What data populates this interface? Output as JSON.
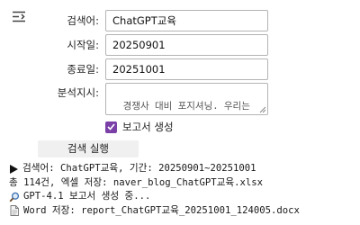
{
  "form": {
    "search_label": "검색어:",
    "search_value": "ChatGPT교육",
    "start_label": "시작일:",
    "start_value": "20250901",
    "end_label": "종료일:",
    "end_value": "20251001",
    "analysis_label": "분석지시:",
    "analysis_value": "경쟁사 대비 포지셔닝. 우리는 '한국GPT협회'임",
    "report_checkbox_label": "보고서 생성",
    "report_checked": true,
    "run_button_label": "검색 실행"
  },
  "log": [
    {
      "icon": "play-arrow-icon",
      "text": "검색어: ChatGPT교육, 기간: 20250901~20251001"
    },
    {
      "icon": "",
      "text": "총 114건, 엑셀 저장: naver_blog_ChatGPT교육.xlsx"
    },
    {
      "icon": "magnifier-icon",
      "text": "GPT-4.1 보고서 생성 중..."
    },
    {
      "icon": "document-icon",
      "text": "Word 저장: report_ChatGPT교육_20251001_124005.docx"
    }
  ],
  "colors": {
    "checkbox": "#7b3fa8",
    "button_bg": "#f0f0f0",
    "field_border": "#b4b4b4"
  }
}
